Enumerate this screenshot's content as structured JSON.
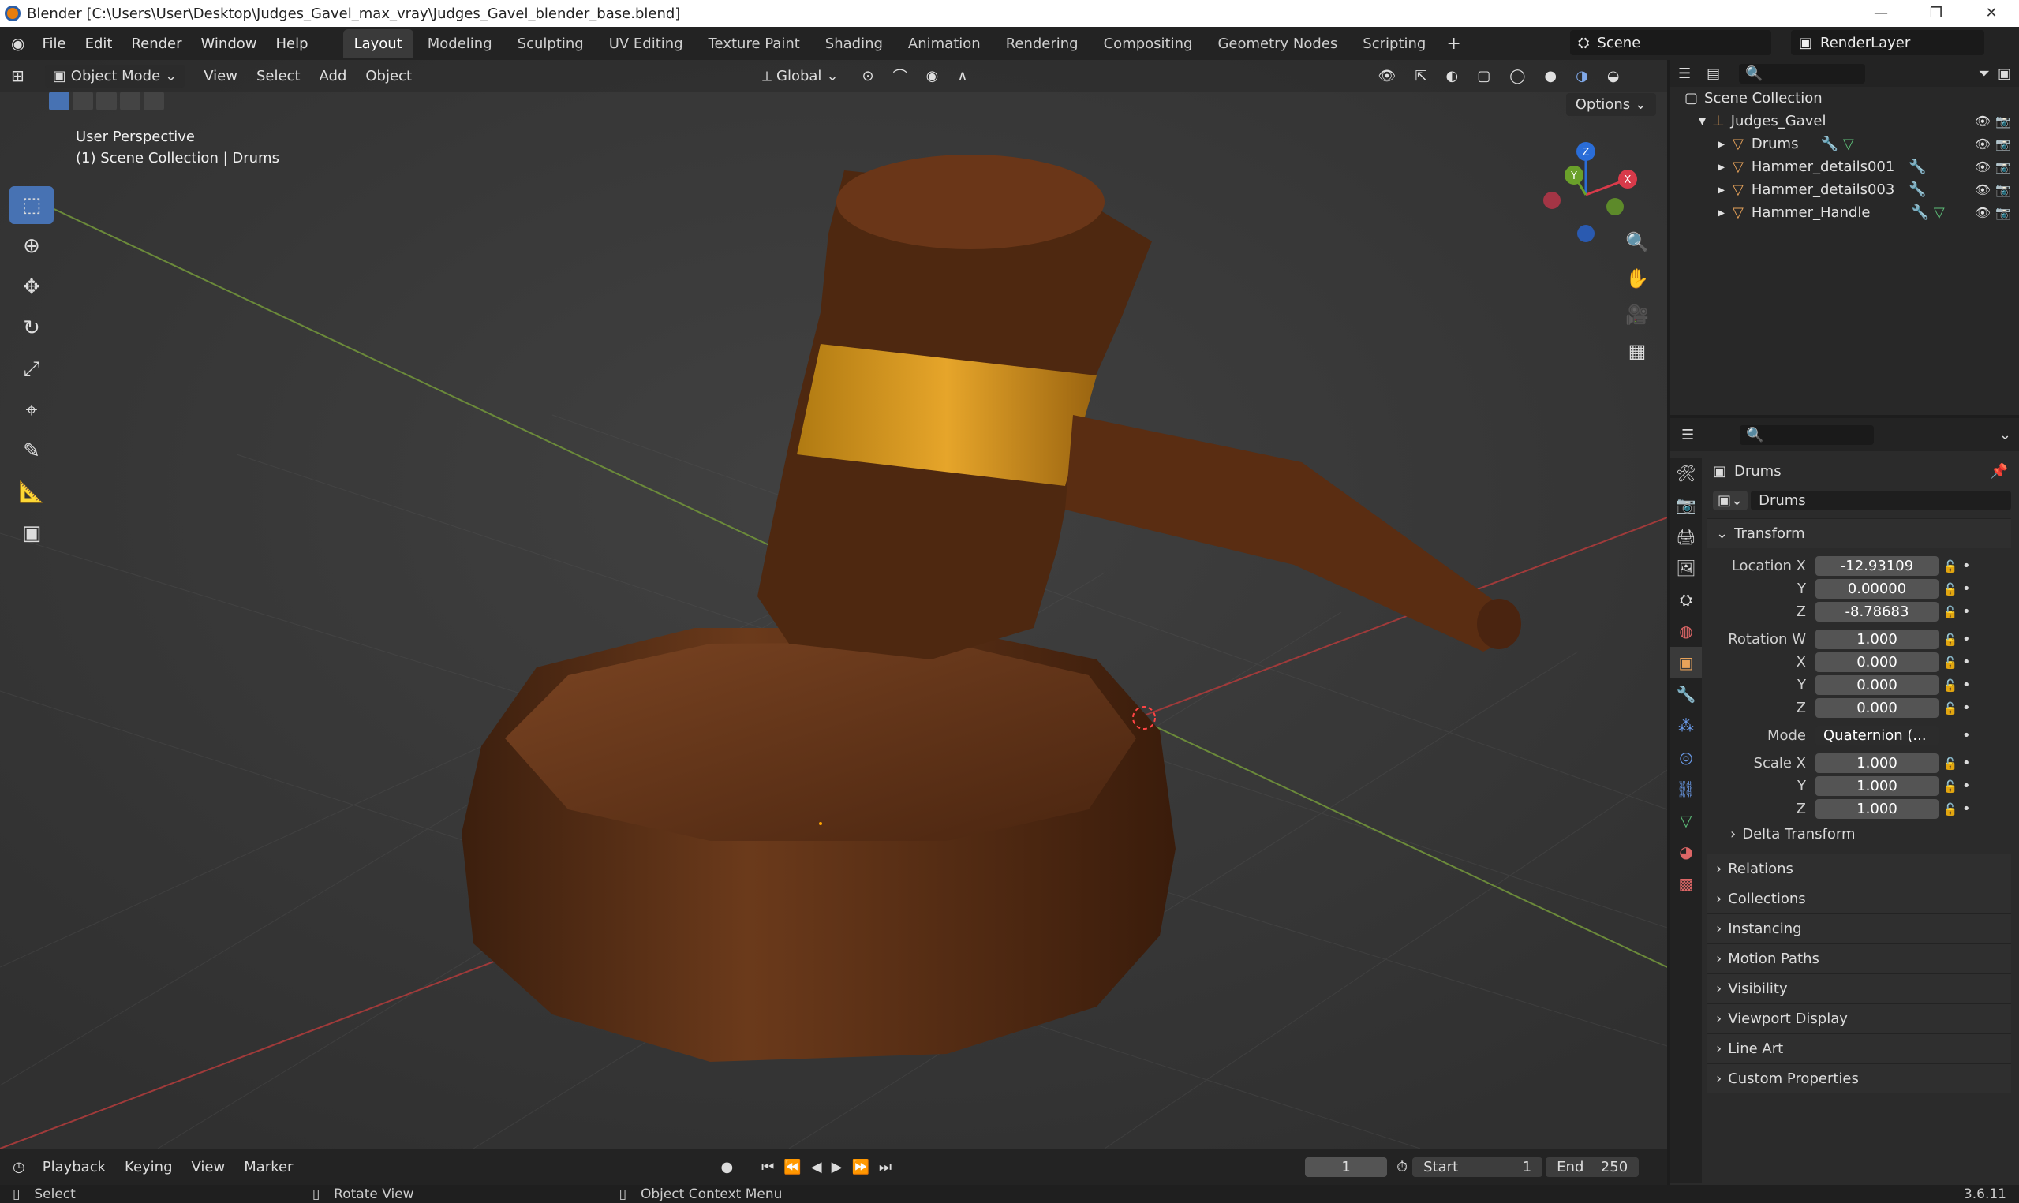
{
  "window": {
    "title": "Blender [C:\\Users\\User\\Desktop\\Judges_Gavel_max_vray\\Judges_Gavel_blender_base.blend]"
  },
  "menubar": {
    "items": [
      "File",
      "Edit",
      "Render",
      "Window",
      "Help"
    ]
  },
  "workspaces": [
    "Layout",
    "Modeling",
    "Sculpting",
    "UV Editing",
    "Texture Paint",
    "Shading",
    "Animation",
    "Rendering",
    "Compositing",
    "Geometry Nodes",
    "Scripting"
  ],
  "scene": {
    "name": "Scene",
    "render_layer": "RenderLayer"
  },
  "viewport": {
    "mode": "Object Mode",
    "menu": [
      "View",
      "Select",
      "Add",
      "Object"
    ],
    "orientation": "Global",
    "info_line1": "User Perspective",
    "info_line2": "(1) Scene Collection | Drums",
    "options": "Options"
  },
  "outliner": {
    "root": "Scene Collection",
    "collection": "Judges_Gavel",
    "objects": [
      "Drums",
      "Hammer_details001",
      "Hammer_details003",
      "Hammer_Handle"
    ]
  },
  "properties": {
    "object_name": "Drums",
    "data_name": "Drums",
    "transform_header": "Transform",
    "location": {
      "label": "Location X",
      "x": "-12.93109",
      "y": "0.00000",
      "z": "-8.78683"
    },
    "rotation": {
      "label": "Rotation W",
      "w": "1.000",
      "x": "0.000",
      "y": "0.000",
      "z": "0.000"
    },
    "mode": {
      "label": "Mode",
      "value": "Quaternion (..."
    },
    "scale": {
      "label": "Scale X",
      "x": "1.000",
      "y": "1.000",
      "z": "1.000"
    },
    "axis": {
      "y": "Y",
      "z": "Z",
      "x": "X"
    },
    "delta": "Delta Transform",
    "panels": [
      "Relations",
      "Collections",
      "Instancing",
      "Motion Paths",
      "Visibility",
      "Viewport Display",
      "Line Art",
      "Custom Properties"
    ]
  },
  "timeline": {
    "menu": [
      "Playback",
      "Keying",
      "View",
      "Marker"
    ],
    "current_frame": "1",
    "start_label": "Start",
    "start": "1",
    "end_label": "End",
    "end": "250"
  },
  "status": {
    "select": "Select",
    "rotate": "Rotate View",
    "context": "Object Context Menu",
    "version": "3.6.11"
  }
}
